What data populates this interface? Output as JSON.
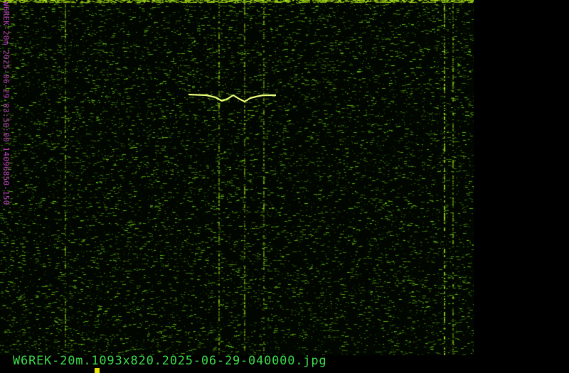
{
  "waterfall": {
    "side_label": "W6REK-20m 2025-06-29 03:50:00 14096850-150",
    "background_color": "#020600",
    "noise_color": "#2f8a12",
    "bright_color": "#c6f23a",
    "signal_color": "#eaff7a"
  },
  "caption": {
    "filename": "W6REK-20m.1093x820.2025-06-29-040000.jpg",
    "color": "#3ddc4a"
  },
  "marker": {
    "color": "#e8e000"
  },
  "label_color": "#c040c0"
}
